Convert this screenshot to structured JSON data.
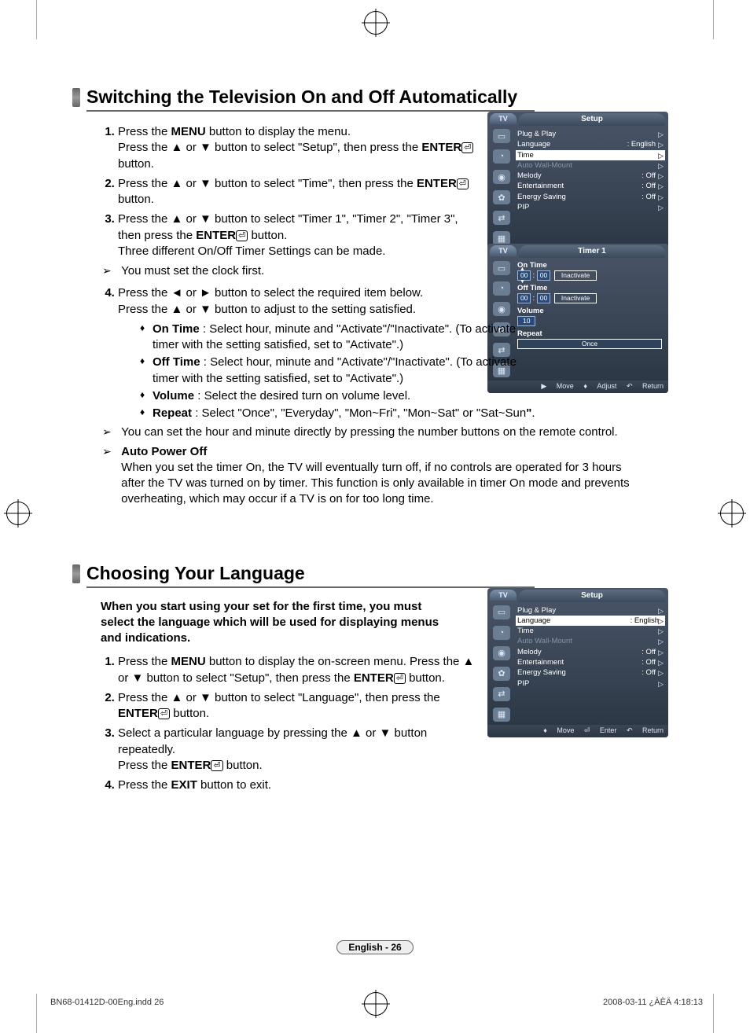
{
  "section1": {
    "title": "Switching the Television On and Off Automatically",
    "step1": "Press the <b>MENU</b> button to display the menu.<br>Press the ▲ or ▼ button to select \"Setup\", then press the <b>ENTER</b><span class='enter-ic'>⏎</span> button.",
    "step2": "Press the ▲ or ▼ button to select \"Time\", then press the <b>ENTER</b><span class='enter-ic'>⏎</span> button.",
    "step3": "Press the ▲ or ▼ button to select \"Timer 1\", \"Timer 2\", \"Timer 3\", then press the <b>ENTER</b><span class='enter-ic'>⏎</span> button.<br>Three different On/Off Timer Settings can be made.",
    "note1": "You must set the clock first.",
    "step4": "Press the ◄ or ► button to select the required item below.<br>Press the ▲ or ▼ button to adjust to the setting satisfied.",
    "bullet1": "<b>On Time</b> : Select hour, minute and \"Activate\"/\"Inactivate\". (To activate timer with the setting satisfied, set to \"Activate\".)",
    "bullet2": "<b>Off Time</b> : Select hour, minute and \"Activate\"/\"Inactivate\". (To activate timer with the setting satisfied, set to \"Activate\".)",
    "bullet3": "<b>Volume</b> : Select the desired turn on volume level.",
    "bullet4": "<b>Repeat</b> : Select \"Once\", \"Everyday\", \"Mon~Fri\", \"Mon~Sat\" or \"Sat~Sun<b>\"</b>.",
    "note2": "You can set the hour and minute directly by pressing the number buttons on the remote control.",
    "note3_title": "Auto Power Off",
    "note3_body": "When you set the timer On, the TV will eventually turn off, if no controls are operated for 3 hours after the TV was turned on by timer. This function is only available in timer On mode and prevents overheating, which may occur if a TV is on for too long time."
  },
  "section2": {
    "title": "Choosing Your Language",
    "intro": "When you start using your set for the first time, you must select the language which will be used for displaying menus and indications.",
    "step1": "Press the <b>MENU</b> button to display the on-screen menu. Press the ▲ or ▼ button to select \"Setup\", then press the <b>ENTER</b><span class='enter-ic'>⏎</span> button.",
    "step2": "Press the ▲ or ▼ button to select \"Language\", then press the <b>ENTER</b><span class='enter-ic'>⏎</span> button.",
    "step3": "Select a particular language by pressing the ▲ or ▼ button repeatedly.<br>Press the <b>ENTER</b><span class='enter-ic'>⏎</span> button.",
    "step4": "Press the <b>EXIT</b> button to exit."
  },
  "osd_setup": {
    "tab": "TV",
    "title": "Setup",
    "rows": [
      {
        "label": "Plug & Play",
        "value": "",
        "highlight": false
      },
      {
        "label": "Language",
        "value": ": English",
        "highlight": false
      },
      {
        "label": "Time",
        "value": "",
        "highlight": true
      },
      {
        "label": "Auto Wall-Mount",
        "value": "",
        "highlight": false,
        "dim": true
      },
      {
        "label": "Melody",
        "value": ": Off",
        "highlight": false
      },
      {
        "label": "Entertainment",
        "value": ": Off",
        "highlight": false
      },
      {
        "label": "Energy Saving",
        "value": ": Off",
        "highlight": false
      },
      {
        "label": "PIP",
        "value": "",
        "highlight": false
      }
    ],
    "footer": {
      "move": "Move",
      "enter": "Enter",
      "return": "Return"
    }
  },
  "osd_setup2": {
    "tab": "TV",
    "title": "Setup",
    "rows": [
      {
        "label": "Plug & Play",
        "value": "",
        "highlight": false
      },
      {
        "label": "Language",
        "value": ": English",
        "highlight": true
      },
      {
        "label": "Time",
        "value": "",
        "highlight": false
      },
      {
        "label": "Auto Wall-Mount",
        "value": "",
        "highlight": false,
        "dim": true
      },
      {
        "label": "Melody",
        "value": ": Off",
        "highlight": false
      },
      {
        "label": "Entertainment",
        "value": ": Off",
        "highlight": false
      },
      {
        "label": "Energy Saving",
        "value": ": Off",
        "highlight": false
      },
      {
        "label": "PIP",
        "value": "",
        "highlight": false
      }
    ],
    "footer": {
      "move": "Move",
      "enter": "Enter",
      "return": "Return"
    }
  },
  "osd_timer": {
    "tab": "TV",
    "title": "Timer 1",
    "on_time_label": "On Time",
    "on_h": "00",
    "on_m": "00",
    "on_status": "Inactivate",
    "off_time_label": "Off Time",
    "off_h": "00",
    "off_m": "00",
    "off_status": "Inactivate",
    "volume_label": "Volume",
    "volume": "10",
    "repeat_label": "Repeat",
    "repeat": "Once",
    "footer": {
      "move": "Move",
      "adjust": "Adjust",
      "return": "Return"
    }
  },
  "page_label": "English - 26",
  "footer_left": "BN68-01412D-00Eng.indd   26",
  "footer_right": "2008-03-11   ¿ÀÈÄ 4:18:13",
  "glyphs": {
    "move_ud": "♦",
    "enter": "⏎",
    "return": "↶",
    "move_r": "▶"
  }
}
